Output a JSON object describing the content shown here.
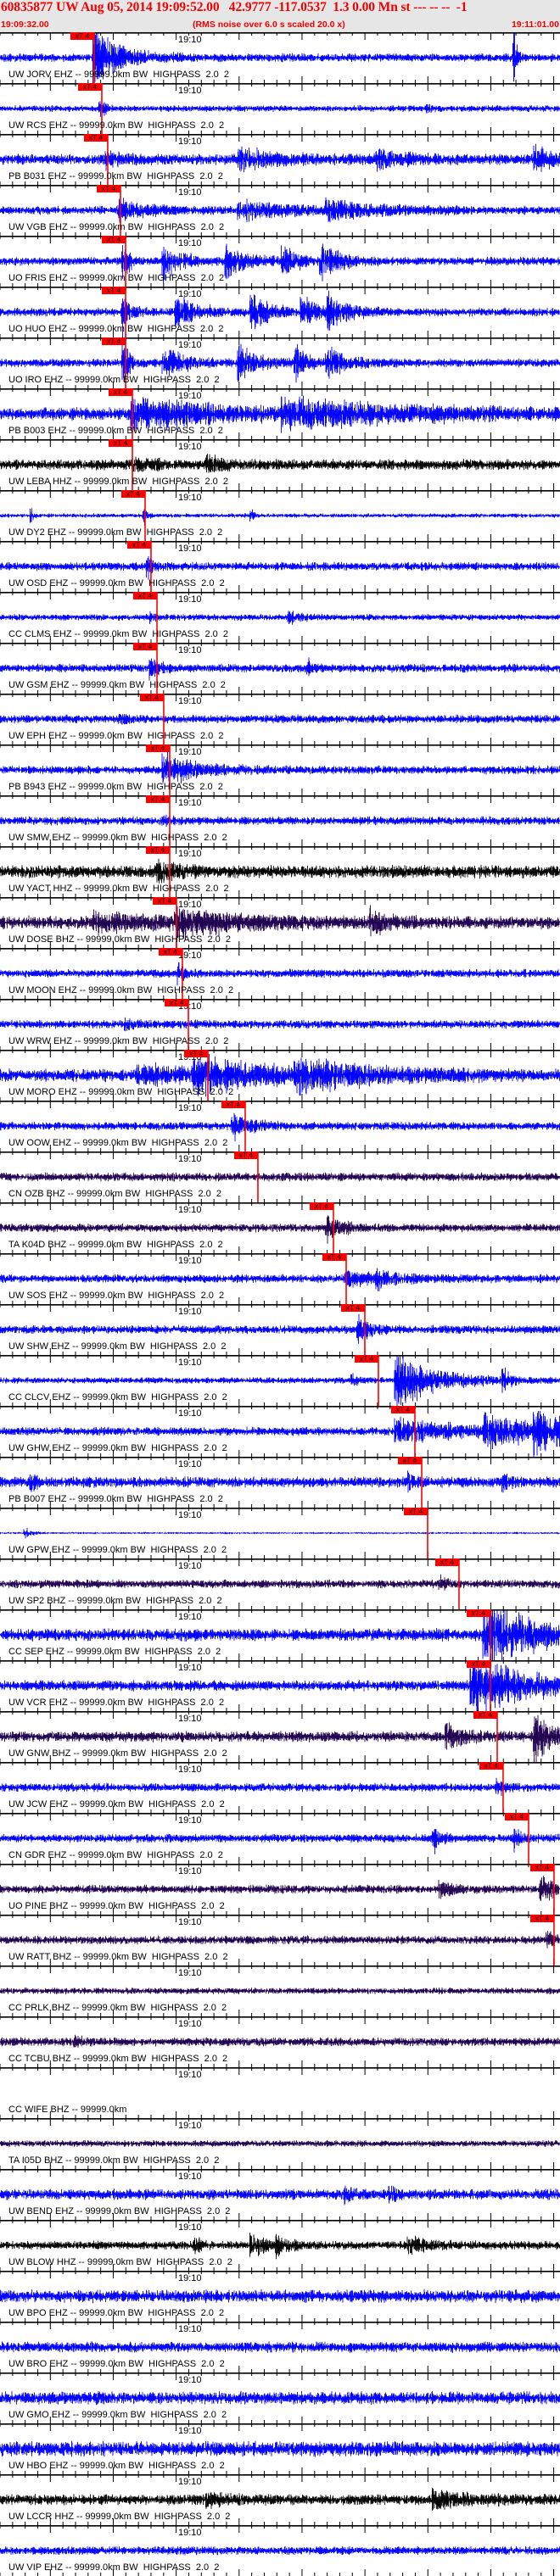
{
  "header": {
    "title": "60835877 UW Aug 05, 2014 19:09:52.00   42.9777 -117.0537  1.3 0.00 Mn st --- -- --  -1",
    "start_time": "19:09:32.00",
    "note": "(RMS noise over 6.0 s scaled 20.0 x)",
    "end_time": "19:11:01.00"
  },
  "time_axis": {
    "duration_s": 89,
    "minute_label": "19:10",
    "minute_offset_s": 28,
    "minor_tick_s": 2,
    "major_tick_s": 10
  },
  "pick_label": "xT 4",
  "colors": {
    "header_text": "#f00000",
    "header_bg": "#e6e6e6",
    "pick": "#ff0000",
    "ehz": "#0000ff",
    "hhz": "#000000",
    "bhz": "#200050"
  },
  "stations": [
    {
      "label": "UW JORV EHZ -- 99999.0km BW  HIGHPASS  2.0  2",
      "color": "#0000ff",
      "pick_s": 14.97
    },
    {
      "label": "UW RCS EHZ -- 99999.0km BW  HIGHPASS  2.0  2",
      "color": "#0000ff",
      "pick_s": 16.18
    },
    {
      "label": "PB B031 EHZ -- 99999.0km BW  HIGHPASS  2.0  2",
      "color": "#0000ff",
      "pick_s": 17.12
    },
    {
      "label": "UW VGB EHZ -- 99999.0km BW  HIGHPASS  2.0  2",
      "color": "#0000ff",
      "pick_s": 19.15
    },
    {
      "label": "UO FRIS EHZ -- 99999.0km BW  HIGHPASS  2.0  2",
      "color": "#0000ff",
      "pick_s": 19.96
    },
    {
      "label": "UO HUO EHZ -- 99999.0km BW  HIGHPASS  2.0  2",
      "color": "#0000ff",
      "pick_s": 19.96
    },
    {
      "label": "UO IRO EHZ -- 99999.0km BW  HIGHPASS  2.0  2",
      "color": "#0000ff",
      "pick_s": 19.96
    },
    {
      "label": "PB B003 EHZ -- 99999.0km BW  HIGHPASS  2.0  2",
      "color": "#0000ff",
      "pick_s": 21.04
    },
    {
      "label": "UW LEBA HHZ -- 99999.0km BW  HIGHPASS  2.0  2",
      "color": "#000000",
      "pick_s": 21.04
    },
    {
      "label": "UW DY2 EHZ -- 99999.0km BW  HIGHPASS  2.0  2",
      "color": "#0000ff",
      "pick_s": 23.06
    },
    {
      "label": "UW OSD EHZ -- 99999.0km BW  HIGHPASS  2.0  2",
      "color": "#0000ff",
      "pick_s": 24.0
    },
    {
      "label": "CC CLMS EHZ -- 99999.0km BW  HIGHPASS  2.0  2",
      "color": "#0000ff",
      "pick_s": 24.95
    },
    {
      "label": "UW GSM EHZ -- 99999.0km BW  HIGHPASS  2.0  2",
      "color": "#0000ff",
      "pick_s": 24.95
    },
    {
      "label": "UW EPH EHZ -- 99999.0km BW  HIGHPASS  2.0  2",
      "color": "#0000ff",
      "pick_s": 26.02
    },
    {
      "label": "PB B943 EHZ -- 99999.0km BW  HIGHPASS  2.0  2",
      "color": "#0000ff",
      "pick_s": 26.97
    },
    {
      "label": "UW SMW EHZ -- 99999.0km BW  HIGHPASS  2.0  2",
      "color": "#0000ff",
      "pick_s": 26.97
    },
    {
      "label": "UW YACT HHZ -- 99999.0km BW  HIGHPASS  2.0  2",
      "color": "#000000",
      "pick_s": 26.97
    },
    {
      "label": "UW DOSE BHZ -- 99999.0km BW  HIGHPASS  2.0  2",
      "color": "#200050",
      "pick_s": 28.05
    },
    {
      "label": "UW MOON EHZ -- 99999.0km BW  HIGHPASS  2.0  2",
      "color": "#0000ff",
      "pick_s": 28.99
    },
    {
      "label": "UW WRW EHZ -- 99999.0km BW  HIGHPASS  2.0  2",
      "color": "#0000ff",
      "pick_s": 29.94
    },
    {
      "label": "UW MORO EHZ -- 99999.0km BW  HIGHPASS  2.0  2",
      "color": "#0000ff",
      "pick_s": 33.04
    },
    {
      "label": "UW OOW EHZ -- 99999.0km BW  HIGHPASS  2.0  2",
      "color": "#0000ff",
      "pick_s": 38.97
    },
    {
      "label": "CN OZB BHZ -- 99999.0km BW  HIGHPASS  2.0  2",
      "color": "#200050",
      "pick_s": 40.99
    },
    {
      "label": "TA K04D BHZ -- 99999.0km BW  HIGHPASS  2.0  2",
      "color": "#200050",
      "pick_s": 52.99
    },
    {
      "label": "UW SOS EHZ -- 99999.0km BW  HIGHPASS  2.0  2",
      "color": "#0000ff",
      "pick_s": 55.02
    },
    {
      "label": "UW SHW EHZ -- 99999.0km BW  HIGHPASS  2.0  2",
      "color": "#0000ff",
      "pick_s": 57.98
    },
    {
      "label": "CC CLCV EHZ -- 99999.0km BW  HIGHPASS  2.0  2",
      "color": "#0000ff",
      "pick_s": 60.14
    },
    {
      "label": "UW GHW EHZ -- 99999.0km BW  HIGHPASS  2.0  2",
      "color": "#0000ff",
      "pick_s": 65.94
    },
    {
      "label": "PB B007 EHZ -- 99999.0km BW  HIGHPASS  2.0  2",
      "color": "#0000ff",
      "pick_s": 67.02
    },
    {
      "label": "UW GPW EHZ -- 99999.0km BW  HIGHPASS  2.0  2",
      "color": "#0000ff",
      "pick_s": 67.96
    },
    {
      "label": "UW SP2 BHZ -- 99999.0km BW  HIGHPASS  2.0  2",
      "color": "#200050",
      "pick_s": 72.95
    },
    {
      "label": "CC SEP EHZ -- 99999.0km BW  HIGHPASS  2.0  2",
      "color": "#0000ff",
      "pick_s": 77.94
    },
    {
      "label": "UW VCR EHZ -- 99999.0km BW  HIGHPASS  2.0  2",
      "color": "#0000ff",
      "pick_s": 77.94
    },
    {
      "label": "UW GNW BHZ -- 99999.0km BW  HIGHPASS  2.0  2",
      "color": "#200050",
      "pick_s": 79.02
    },
    {
      "label": "UW JCW EHZ -- 99999.0km BW  HIGHPASS  2.0  2",
      "color": "#0000ff",
      "pick_s": 79.96
    },
    {
      "label": "CN GDR EHZ -- 99999.0km BW  HIGHPASS  2.0  2",
      "color": "#0000ff",
      "pick_s": 84.01
    },
    {
      "label": "UO PINE BHZ -- 99999.0km BW  HIGHPASS  2.0  2",
      "color": "#200050",
      "pick_s": 88.05
    },
    {
      "label": "UW RATT BHZ -- 99999.0km BW  HIGHPASS  2.0  2",
      "color": "#200050",
      "pick_s": 88.05
    },
    {
      "label": "CC PRLK BHZ -- 99999.0km BW  HIGHPASS  2.0  2",
      "color": "#200050",
      "pick_s": null
    },
    {
      "label": "CC TCBU BHZ -- 99999.0km BW  HIGHPASS  2.0  2",
      "color": "#200050",
      "pick_s": null
    },
    {
      "label": "CC WIFE BHZ -- 99999.0km",
      "color": "#200050",
      "pick_s": null
    },
    {
      "label": "TA I05D BHZ -- 99999.0km BW  HIGHPASS  2.0  2",
      "color": "#200050",
      "pick_s": null
    },
    {
      "label": "UW BEND EHZ -- 99999.0km BW  HIGHPASS  2.0  2",
      "color": "#0000ff",
      "pick_s": null
    },
    {
      "label": "UW BLOW HHZ -- 99999.0km BW  HIGHPASS  2.0  2",
      "color": "#000000",
      "pick_s": null
    },
    {
      "label": "UW BPO EHZ -- 99999.0km BW  HIGHPASS  2.0  2",
      "color": "#0000ff",
      "pick_s": null
    },
    {
      "label": "UW BRO EHZ -- 99999.0km BW  HIGHPASS  2.0  2",
      "color": "#0000ff",
      "pick_s": null
    },
    {
      "label": "UW GMO EHZ -- 99999.0km BW  HIGHPASS  2.0  2",
      "color": "#0000ff",
      "pick_s": null
    },
    {
      "label": "UW HBO EHZ -- 99999.0km BW  HIGHPASS  2.0  2",
      "color": "#0000ff",
      "pick_s": null
    },
    {
      "label": "UW LCCR HHZ -- 99999.0km BW  HIGHPASS  2.0  2",
      "color": "#000000",
      "pick_s": null
    },
    {
      "label": "UW VIP EHZ -- 99999.0km BW  HIGHPASS  2.0  2",
      "color": "#0000ff",
      "pick_s": null
    }
  ]
}
